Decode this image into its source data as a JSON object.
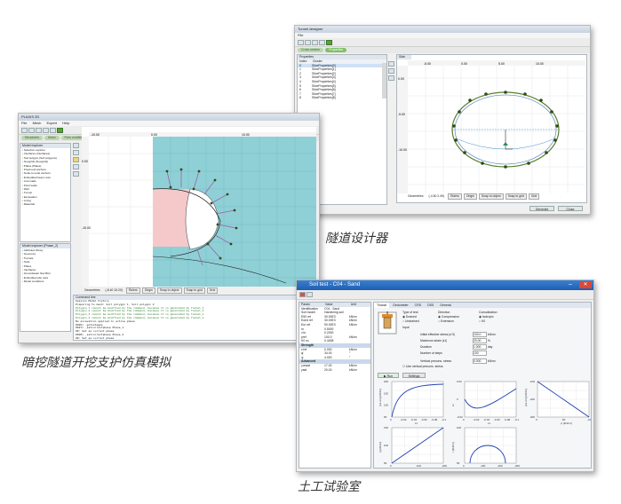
{
  "tunnel": {
    "title": "Tunnel designer",
    "menu": [
      "File"
    ],
    "modes": [
      "Cross section",
      "Properties"
    ],
    "properties_tab": "Properties",
    "columns": [
      "Index",
      "Cluster"
    ],
    "rows": [
      {
        "index": "0",
        "cluster": "SliceProperties[0]"
      },
      {
        "index": "1",
        "cluster": "SliceProperties[1]"
      },
      {
        "index": "2",
        "cluster": "SliceProperties[2]"
      },
      {
        "index": "3",
        "cluster": "SliceProperties[3]"
      },
      {
        "index": "4",
        "cluster": "SliceProperties[4]"
      },
      {
        "index": "5",
        "cluster": "SliceProperties[5]"
      },
      {
        "index": "6",
        "cluster": "SliceProperties[6]"
      },
      {
        "index": "7",
        "cluster": "SliceProperties[7]"
      },
      {
        "index": "8",
        "cluster": "SliceProperties[8]"
      }
    ],
    "view_tab": "Side",
    "ruler_top": [
      "-5.00",
      "0.00",
      "5.00",
      "10.00"
    ],
    "ruler_left": [
      "0.00",
      "-5.00",
      "-10.00"
    ],
    "status": [
      "Geometries",
      "(-4.50  2.49)",
      "Rulers",
      "Origin",
      "Snap to object",
      "Snap to grid",
      "Grid"
    ],
    "buttons": [
      "Generate",
      "Close"
    ],
    "caption": "隧道设计器"
  },
  "excavation": {
    "title": "PLAXIS 2D",
    "menu": [
      "File",
      "Mesh",
      "Expert",
      "Help"
    ],
    "modes": [
      "Structures",
      "Mesh",
      "Flow conditions",
      "Staged construction"
    ],
    "explorer_title": "Model explorer",
    "tree_top": [
      "Selection explorer",
      "Interfaces (Interfaces)",
      "Soil polygon (Soil polygons)",
      "Geogrids (Geogrids)",
      "Plates (Plates)",
      "Fixed-end anchors",
      "Node-to-node anchors",
      "Embedded beam rows",
      "Line loads",
      "Point loads",
      "Well",
      "Tunnel",
      "Excavation",
      "Lining",
      "Materials"
    ],
    "tree_bottom_title": "Model explorer (Phase_2)",
    "tree_bottom": [
      "Attributes library",
      "Geometry",
      "Tunnels",
      "Soils",
      "Plates",
      "Interfaces",
      "Groundwater flow BCs",
      "Embedded pile rows",
      "Model conditions"
    ],
    "ruler_top": [
      "-10.00",
      "0.00",
      "10.00"
    ],
    "ruler_left": [
      "0.00",
      "-10.00"
    ],
    "status": [
      "Geometries",
      "(-8.40  10.20)",
      "Rulers",
      "Origin",
      "Snap to object",
      "Snap to grid",
      "Grid"
    ],
    "console_title": "Command line",
    "console_lines": [
      "Session  Model history",
      "Preparing to mesh: Soil polygon 1, Soil polygon 2",
      "Polygon_1 cannot be modified by the command, because it is generated by Tunnel_1",
      "Polygon_2 cannot be modified by the command, because it is generated by Tunnel_1",
      "Polygon_3 cannot be modified by the command, because it is generated by Tunnel_1",
      "Polygon_4 cannot be modified by the command, because it is generated by Tunnel_1",
      "No excavation applied in active phase",
      "0026> _gotostages",
      "0027> _setcurrentphase Phase_1",
      "OK: Set as current phase",
      "0028> _setcurrentphase Phase_2",
      "OK: Set as current phase"
    ],
    "caption": "暗挖隧道开挖支护仿真模拟"
  },
  "soiltest": {
    "title": "Soil test - C04 - Sand",
    "tabs": [
      "Triaxial",
      "Oedometer",
      "CRS",
      "DSS",
      "General"
    ],
    "params_header": [
      "Param",
      "Value",
      "Unit"
    ],
    "params": [
      {
        "name": "Identification",
        "value": "C04 - Sand",
        "unit": ""
      },
      {
        "name": "Soil model",
        "value": "Hardening soil",
        "unit": ""
      },
      {
        "name": "E50 ref",
        "value": "30.00E3",
        "unit": "kN/m²"
      },
      {
        "name": "Eoed ref",
        "value": "30.00E3",
        "unit": "kN/m²"
      },
      {
        "name": "Eur ref",
        "value": "90.00E3",
        "unit": "kN/m²"
      },
      {
        "name": "m",
        "value": "0.5000",
        "unit": ""
      },
      {
        "name": "ν'ur",
        "value": "0.2000",
        "unit": ""
      },
      {
        "name": "pref",
        "value": "100.0",
        "unit": "kN/m²"
      },
      {
        "name": "K0 nc",
        "value": "0.4408",
        "unit": ""
      },
      {
        "name": "Strength",
        "value": "",
        "unit": ""
      },
      {
        "name": "c'ref",
        "value": "0.000",
        "unit": "kN/m²"
      },
      {
        "name": "φ'",
        "value": "34.00",
        "unit": "°"
      },
      {
        "name": "ψ",
        "value": "4.000",
        "unit": "°"
      },
      {
        "name": "Advanced",
        "value": "",
        "unit": ""
      },
      {
        "name": "γunsat",
        "value": "17.00",
        "unit": "kN/m³"
      },
      {
        "name": "γsat",
        "value": "20.00",
        "unit": "kN/m³"
      }
    ],
    "labels": {
      "type_of_test": "Type of test",
      "drained": "Drained",
      "undrained": "Undrained",
      "direction": "Direction",
      "compression": "Compression",
      "extension": "Extension",
      "consolidation": "Consolidation",
      "isotropic": "Isotropic",
      "k0": "K0",
      "input": "Input",
      "confining": "Initial effective stress |σ'3|",
      "confining_val": "100.0",
      "confining_unit": "kN/m²",
      "max_strain": "Maximum strain |ε1|",
      "max_strain_val": "20.00",
      "max_strain_unit": "%",
      "duration": "Duration",
      "duration_val": "1.000",
      "duration_unit": "day",
      "steps": "Number of steps",
      "steps_val": "100",
      "vertical_prec": "Vertical precons. stress",
      "vertical_prec_val": "0.000",
      "vertical_prec_unit": "kN/m²",
      "use_prec": "Use vertical precons. stress",
      "run_button": "Run",
      "settings_button": "Settings"
    },
    "charts": [
      {
        "ylabel": "|σ1-σ3| [kN/m²]",
        "xlabel": "ε1",
        "xticks": [
          "0",
          "-0.02",
          "-0.04",
          "-0.06",
          "-0.08",
          "-0.1"
        ],
        "yticks": [
          "200",
          "150",
          "100",
          "50"
        ]
      },
      {
        "ylabel": "εv",
        "xlabel": "ε1",
        "xticks": [
          "0",
          "-0.02",
          "-0.04",
          "-0.06",
          "-0.08",
          "-0.1"
        ],
        "yticks": [
          "0.02",
          "0",
          "-0.02"
        ]
      },
      {
        "ylabel": "|σ1-σ3| [kN/m²]",
        "xlabel": "p' [kN/m²]",
        "xticks": [
          "0",
          "-50",
          "-100"
        ],
        "yticks": [
          "-100",
          "-200",
          "-300"
        ]
      },
      {
        "ylabel": "q [kN/m²]",
        "xlabel": "p' [kN/m²]",
        "xticks": [
          "0",
          "-100",
          "-200"
        ],
        "yticks": [
          "150",
          "100",
          "50"
        ]
      },
      {
        "ylabel": "τ [kN/m²]",
        "xlabel": "σ' [kN/m²]",
        "xticks": [
          "0",
          "-100",
          "-200",
          "-300"
        ],
        "yticks": [
          "100",
          "50"
        ]
      }
    ],
    "caption": "土工试验室"
  }
}
